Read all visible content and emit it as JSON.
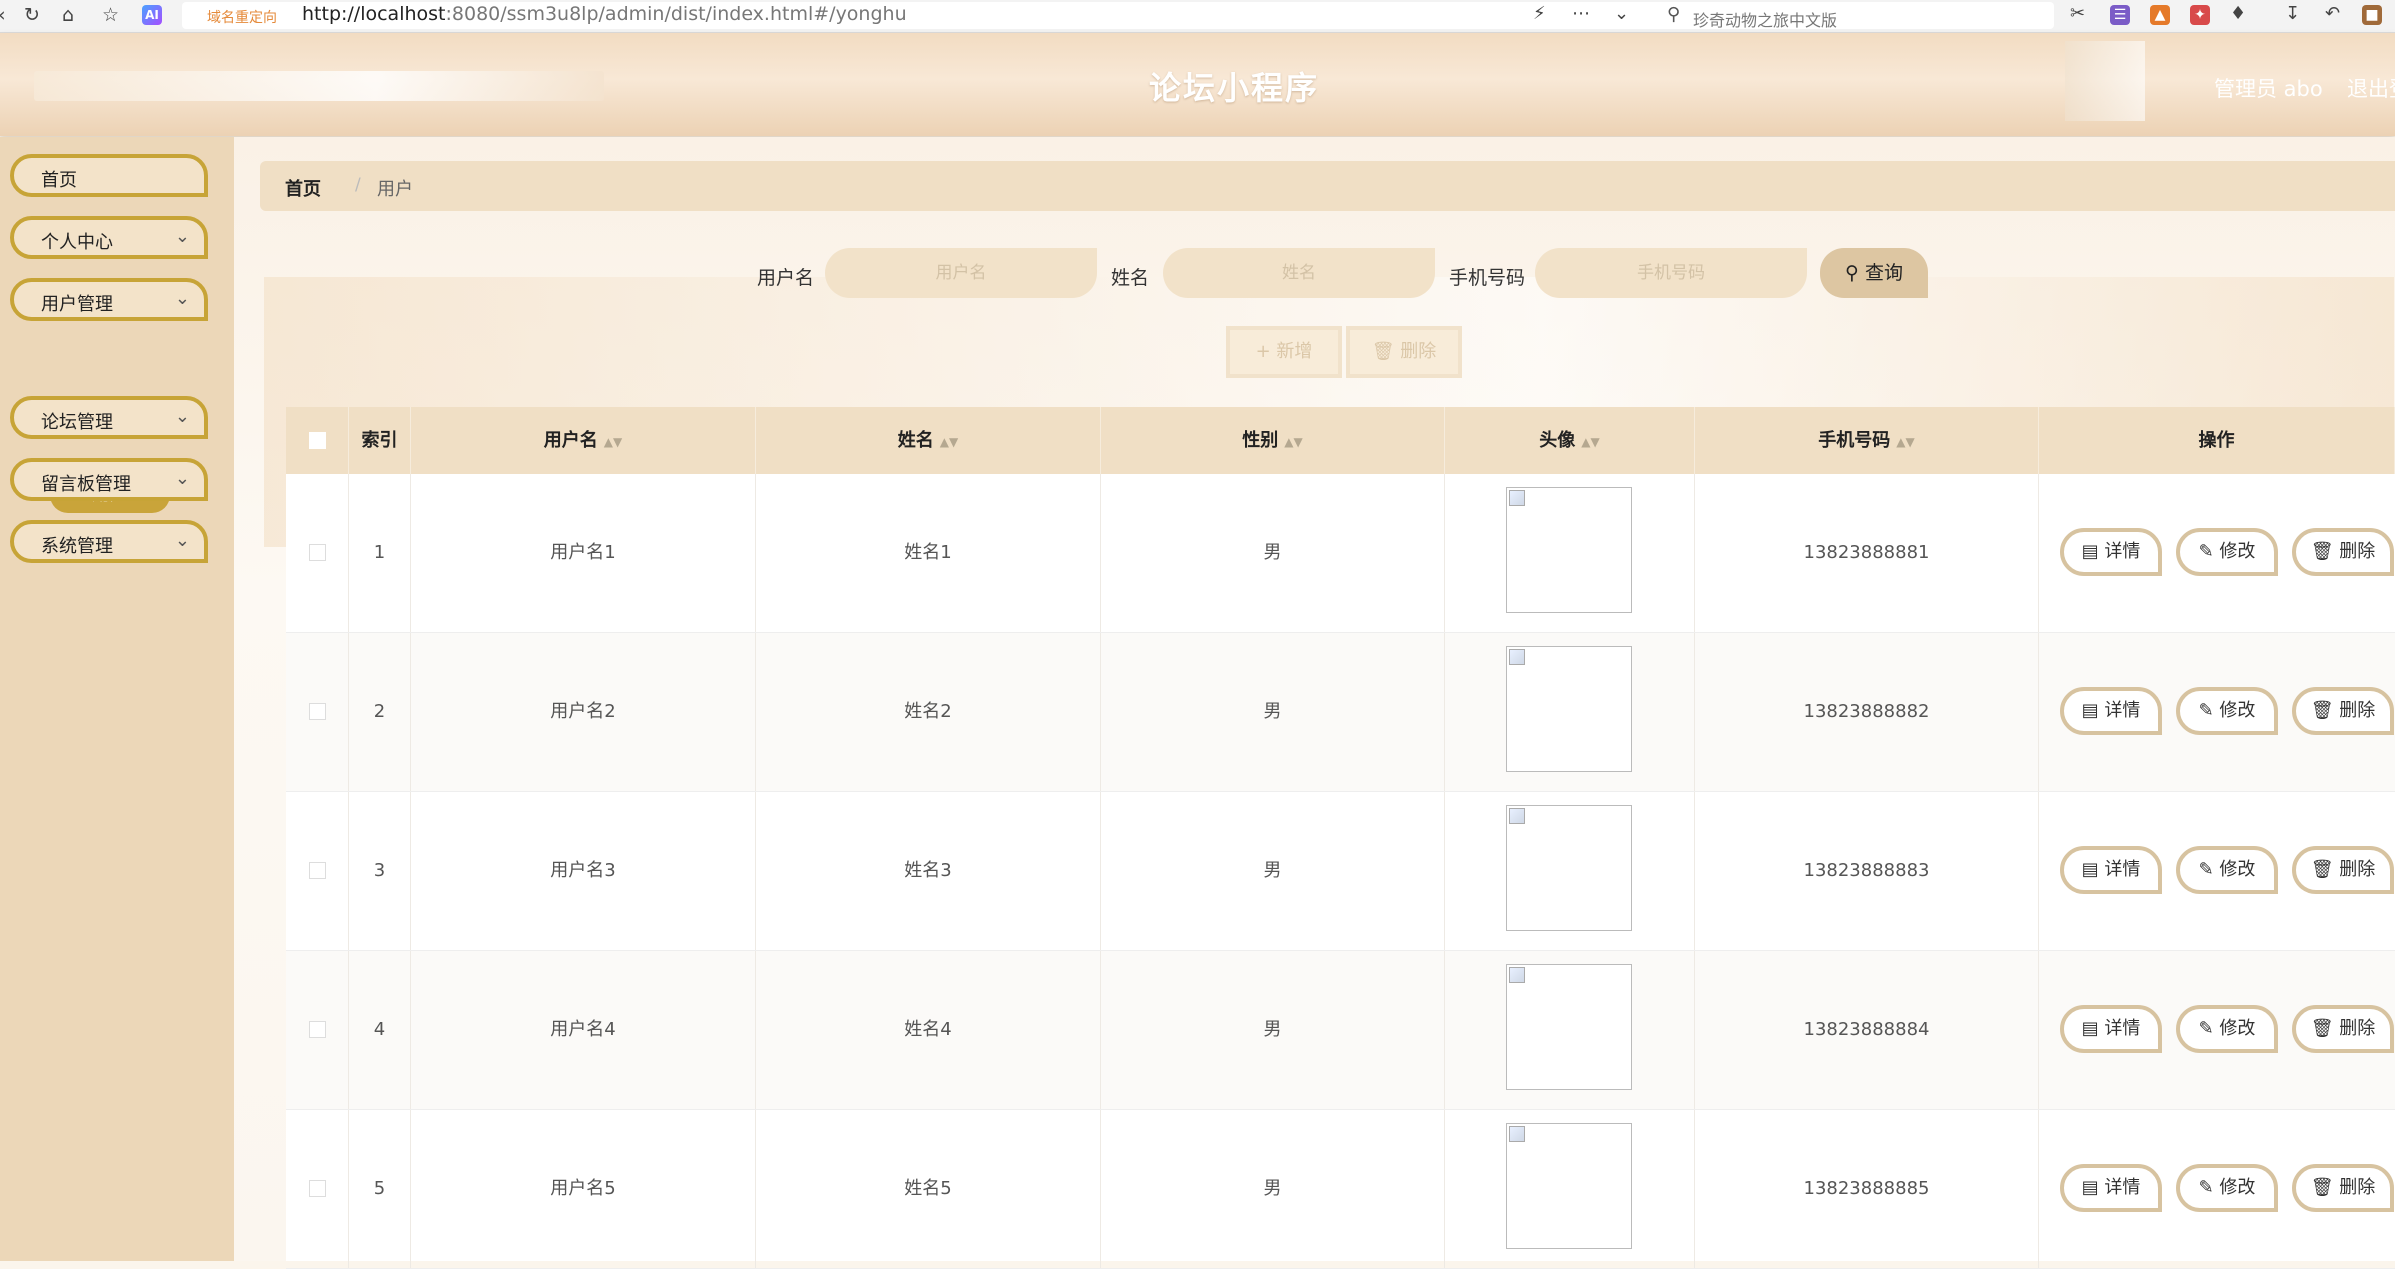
{
  "browser": {
    "redirect_label": "域名重定向",
    "url_host": "http://localhost",
    "url_rest": ":8080/ssm3u8lp/admin/dist/index.html#/yonghu",
    "search_placeholder": "珍奇动物之旅中文版"
  },
  "header": {
    "title": "论坛小程序",
    "admin_label": "管理员 abo",
    "logout_label": "退出登录"
  },
  "sidebar": {
    "items": [
      {
        "label": "首页"
      },
      {
        "label": "个人中心"
      },
      {
        "label": "用户管理"
      },
      {
        "label": "论坛管理"
      },
      {
        "label": "留言板管理"
      },
      {
        "label": "系统管理"
      }
    ],
    "active_sub": "用户"
  },
  "breadcrumb": {
    "home": "首页",
    "separator": "/",
    "current": "用户"
  },
  "search": {
    "username_label": "用户名",
    "username_placeholder": "用户名",
    "name_label": "姓名",
    "name_placeholder": "姓名",
    "phone_label": "手机号码",
    "phone_placeholder": "手机号码",
    "query_label": "查询"
  },
  "actions": {
    "add_label": "新增",
    "delete_label": "删除"
  },
  "table": {
    "headers": [
      "索引",
      "用户名",
      "姓名",
      "性别",
      "头像",
      "手机号码",
      "操作"
    ],
    "rows": [
      {
        "index": "1",
        "username": "用户名1",
        "name": "姓名1",
        "gender": "男",
        "phone": "13823888881"
      },
      {
        "index": "2",
        "username": "用户名2",
        "name": "姓名2",
        "gender": "男",
        "phone": "13823888882"
      },
      {
        "index": "3",
        "username": "用户名3",
        "name": "姓名3",
        "gender": "男",
        "phone": "13823888883"
      },
      {
        "index": "4",
        "username": "用户名4",
        "name": "姓名4",
        "gender": "男",
        "phone": "13823888884"
      },
      {
        "index": "5",
        "username": "用户名5",
        "name": "姓名5",
        "gender": "男",
        "phone": "13823888885"
      }
    ],
    "op_detail": "详情",
    "op_edit": "修改",
    "op_delete": "删除"
  },
  "colors": {
    "accent": "#c7a437",
    "header_bg": "#f0dfc5",
    "sidebar_bg": "#ecd7b8"
  }
}
